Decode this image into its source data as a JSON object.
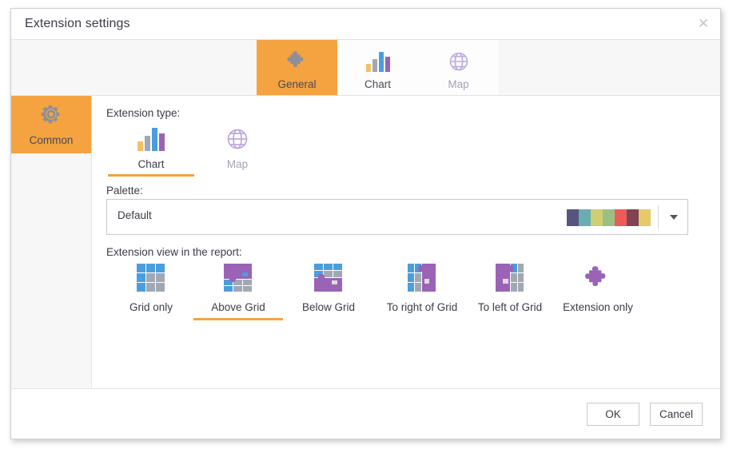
{
  "window": {
    "title": "Extension settings",
    "close_icon": "close-icon"
  },
  "tabs": [
    {
      "label": "General",
      "icon": "puzzle-icon",
      "active": true
    },
    {
      "label": "Chart",
      "icon": "bar-chart-icon",
      "active": false
    },
    {
      "label": "Map",
      "icon": "globe-icon",
      "active": false
    }
  ],
  "sidebar": {
    "items": [
      {
        "label": "Common",
        "icon": "gear-icon",
        "active": true
      }
    ]
  },
  "main": {
    "extension_type": {
      "label": "Extension type:",
      "options": [
        {
          "label": "Chart",
          "icon": "bar-chart-icon",
          "selected": true
        },
        {
          "label": "Map",
          "icon": "globe-icon",
          "selected": false
        }
      ]
    },
    "palette": {
      "label": "Palette:",
      "value": "Default",
      "swatches": [
        "#575480",
        "#6aadb0",
        "#cfce72",
        "#9bbf83",
        "#ec5b57",
        "#7e4454",
        "#e7c96a"
      ],
      "dropdown_icon": "chevron-down-icon"
    },
    "extension_view": {
      "label": "Extension view in the report:",
      "options": [
        {
          "label": "Grid only",
          "icon": "grid-only-icon",
          "selected": false
        },
        {
          "label": "Above Grid",
          "icon": "above-grid-icon",
          "selected": true
        },
        {
          "label": "Below Grid",
          "icon": "below-grid-icon",
          "selected": false
        },
        {
          "label": "To right of Grid",
          "icon": "right-of-grid-icon",
          "selected": false
        },
        {
          "label": "To left of Grid",
          "icon": "left-of-grid-icon",
          "selected": false
        },
        {
          "label": "Extension only",
          "icon": "extension-only-icon",
          "selected": false
        }
      ]
    }
  },
  "footer": {
    "ok_label": "OK",
    "cancel_label": "Cancel"
  },
  "colors": {
    "accent": "#f4a340",
    "grid_blue": "#4a9edd",
    "grid_gray": "#a0a8b4",
    "extension_purple": "#9a63b5"
  }
}
